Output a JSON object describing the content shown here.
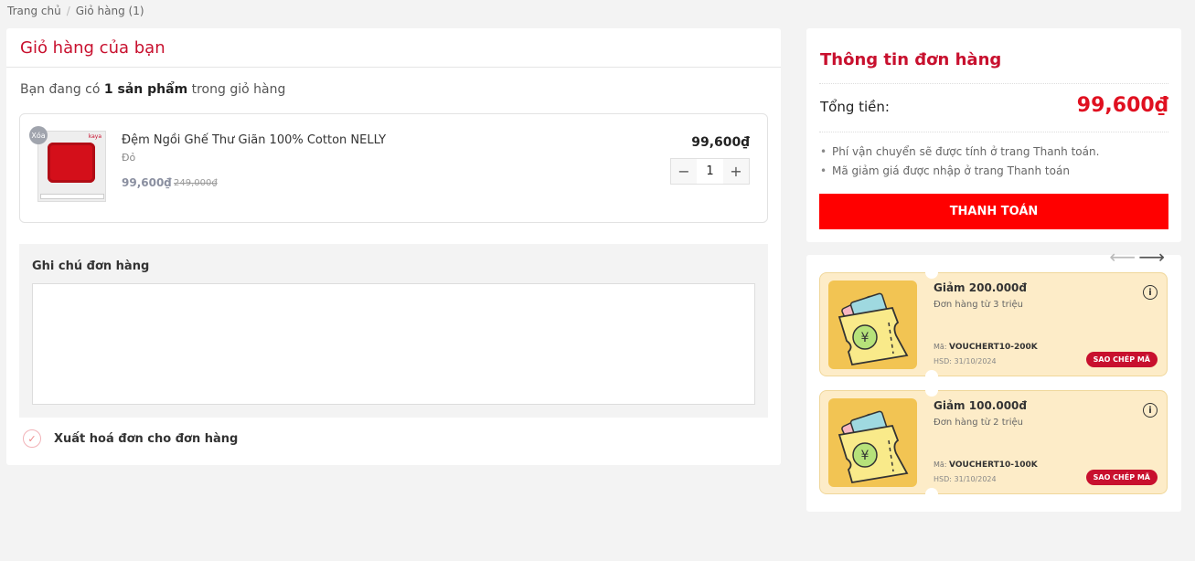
{
  "breadcrumb": {
    "home": "Trang chủ",
    "current": "Giỏ hàng (1)"
  },
  "cart": {
    "title": "Giỏ hàng của bạn",
    "count_prefix": "Bạn đang có ",
    "count_bold": "1 sản phẩm",
    "count_suffix": " trong giỏ hàng",
    "item": {
      "remove_label": "Xóa",
      "brand": "kaya",
      "name": "Đệm Ngồi Ghế Thư Giãn 100% Cotton NELLY",
      "variant": "Đỏ",
      "price": "99,600₫",
      "old_price": "249,000₫",
      "line_total": "99,600₫",
      "quantity": "1"
    },
    "note_label": "Ghi chú đơn hàng",
    "note_value": "",
    "invoice_label": "Xuất hoá đơn cho đơn hàng"
  },
  "summary": {
    "title": "Thông tin đơn hàng",
    "total_label": "Tổng tiền:",
    "total_value": "99,600₫",
    "notes": [
      "Phí vận chuyển sẽ được tính ở trang Thanh toán.",
      "Mã giảm giá được nhập ở trang Thanh toán"
    ],
    "checkout_label": "THANH TOÁN"
  },
  "vouchers": [
    {
      "title": "Giảm 200.000đ",
      "condition": "Đơn hàng từ 3 triệu",
      "code_label": "Mã: ",
      "code": "VOUCHERT10-200K",
      "expiry": "HSD: 31/10/2024",
      "copy_label": "SAO CHÉP MÃ"
    },
    {
      "title": "Giảm 100.000đ",
      "condition": "Đơn hàng từ 2 triệu",
      "code_label": "Mã: ",
      "code": "VOUCHERT10-100K",
      "expiry": "HSD: 31/10/2024",
      "copy_label": "SAO CHÉP MÃ"
    }
  ],
  "colors": {
    "brand_red": "#c8102e",
    "checkout_red": "#ff0000",
    "voucher_bg": "#fdecc8"
  }
}
